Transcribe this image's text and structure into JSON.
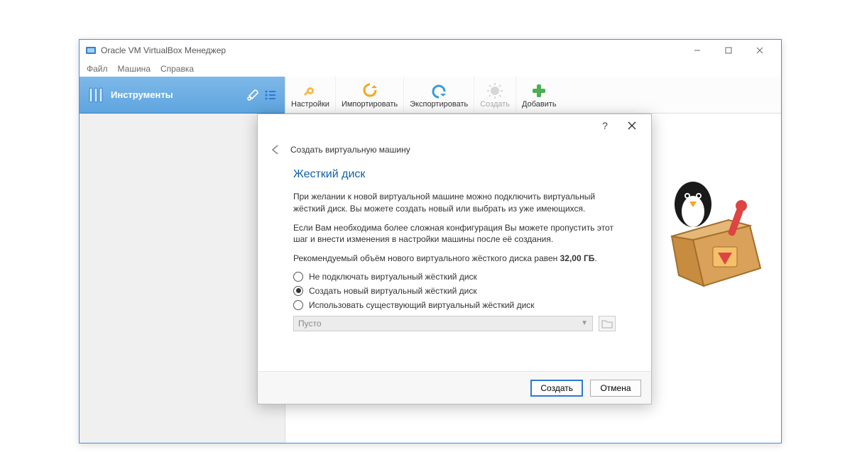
{
  "window": {
    "title": "Oracle VM VirtualBox Менеджер",
    "menu": {
      "file": "Файл",
      "machine": "Машина",
      "help": "Справка"
    }
  },
  "sidebar": {
    "tools_label": "Инструменты"
  },
  "toolbar": {
    "settings": "Настройки",
    "import": "Импортировать",
    "export": "Экспортировать",
    "create": "Создать",
    "add": "Добавить"
  },
  "dialog": {
    "nav_title": "Создать виртуальную машину",
    "heading": "Жесткий диск",
    "para1": "При желании к новой виртуальной машине можно подключить виртуальный жёсткий диск. Вы можете создать новый или выбрать из уже имеющихся.",
    "para2": "Если Вам необходима более сложная конфигурация Вы можете пропустить этот шаг и внести изменения в настройки машины после её создания.",
    "para3_prefix": "Рекомендуемый объём нового виртуального жёсткого диска равен ",
    "para3_size": "32,00 ГБ",
    "para3_suffix": ".",
    "radios": {
      "none": "Не подключать виртуальный жёсткий диск",
      "create": "Создать новый виртуальный жёсткий диск",
      "existing": "Использовать существующий виртуальный жёсткий диск"
    },
    "combo_value": "Пусто",
    "footer": {
      "create": "Создать",
      "cancel": "Отмена"
    },
    "help": "?"
  }
}
